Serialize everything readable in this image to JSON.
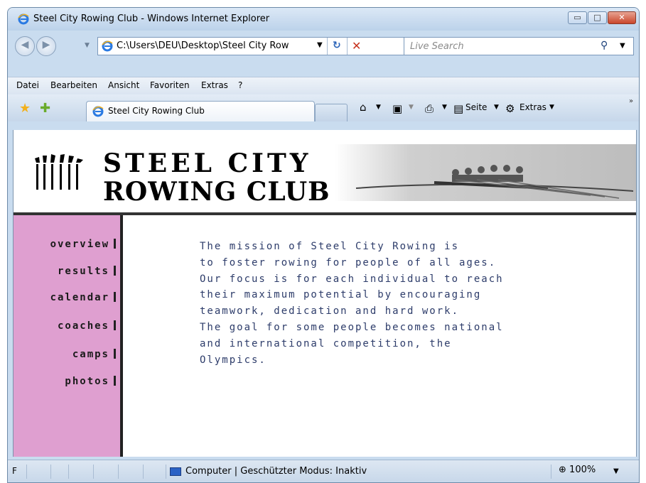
{
  "window": {
    "title": "Steel City Rowing Club - Windows Internet Explorer",
    "icon": "ie-icon",
    "buttons": {
      "minimize": "▭",
      "maximize": "□",
      "close": "✕"
    }
  },
  "navigation": {
    "back_icon": "back-arrow-icon",
    "forward_icon": "forward-arrow-icon",
    "address": "C:\\Users\\DEU\\Desktop\\Steel City Row",
    "search_placeholder": "Live Search"
  },
  "menu": {
    "items": [
      "Datei",
      "Bearbeiten",
      "Ansicht",
      "Favoriten",
      "Extras",
      "?"
    ]
  },
  "favorites_bar": {
    "tab_label": "Steel City Rowing Club",
    "page_label": "Seite",
    "tools_label": "Extras",
    "more": "»"
  },
  "site": {
    "logo_line1": "STEEL CITY",
    "logo_line2": "ROWING CLUB",
    "nav": [
      "overview",
      "results",
      "calendar",
      "coaches",
      "camps",
      "photos"
    ],
    "mission_lines": [
      "The mission of Steel City Rowing is",
      "to foster rowing for people of all ages.",
      "Our focus is for each individual to reach",
      "their maximum potential by encouraging",
      "teamwork, dedication and hard work.",
      "The goal for some people becomes national",
      "and international competition, the",
      "Olympics."
    ],
    "colors": {
      "nav_bg": "#df9fd0",
      "mission_text": "#2d3c6a"
    }
  },
  "statusbar": {
    "left": "F",
    "zone": "Computer | Geschützter Modus: Inaktiv",
    "zoom": "100%"
  }
}
